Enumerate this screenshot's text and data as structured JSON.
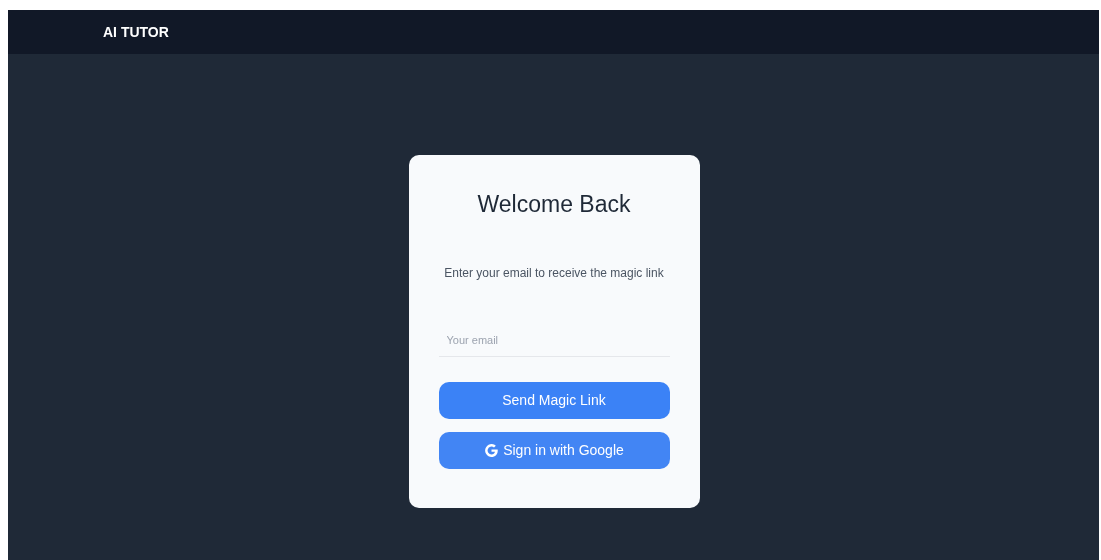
{
  "header": {
    "brand": "AI TUTOR"
  },
  "card": {
    "title": "Welcome Back",
    "subtitle": "Enter your email to receive the magic link",
    "email": {
      "placeholder": "Your email"
    },
    "buttons": [
      {
        "kind": "magic",
        "label": "Send Magic Link"
      },
      {
        "kind": "google",
        "label": "Sign in with Google"
      }
    ]
  }
}
